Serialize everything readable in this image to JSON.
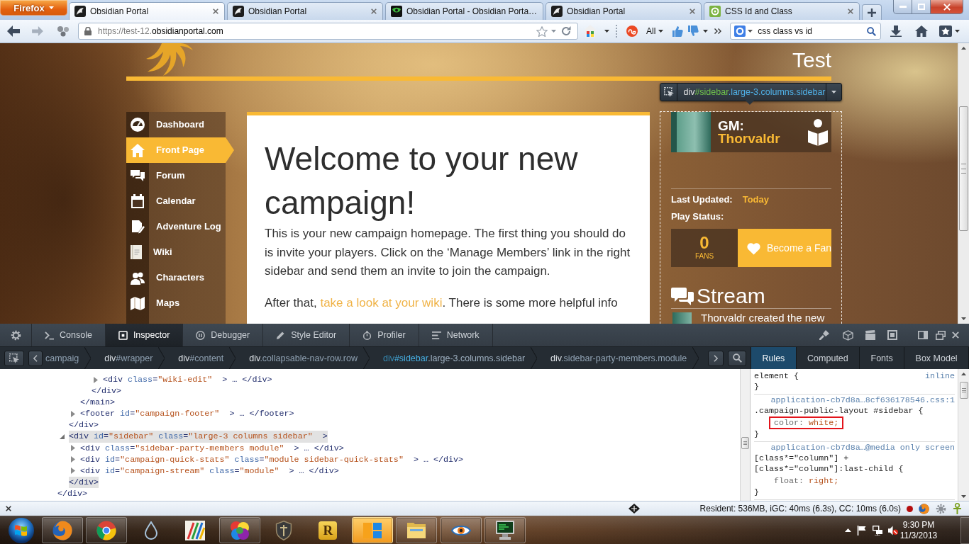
{
  "browser": {
    "menu_button": "Firefox",
    "tabs": [
      {
        "title": "Obsidian Portal",
        "selected": true
      },
      {
        "title": "Obsidian Portal",
        "selected": false
      },
      {
        "title": "Obsidian Portal - Obsidian Porta…",
        "selected": false
      },
      {
        "title": "Obsidian Portal",
        "selected": false
      },
      {
        "title": "CSS Id and Class",
        "selected": false
      }
    ],
    "address": {
      "prefix": "https://test-12.",
      "domain": "obsidianportal.com"
    },
    "toolbar_menu": "All",
    "search": {
      "value": "css class vs id"
    }
  },
  "page": {
    "campaign_title": "Test",
    "infobar": {
      "tag": "div",
      "id": "#sidebar",
      "classes": ".large-3.columns.sidebar"
    },
    "nav": [
      {
        "label": "Dashboard",
        "selected": false
      },
      {
        "label": "Front Page",
        "selected": true
      },
      {
        "label": "Forum",
        "selected": false
      },
      {
        "label": "Calendar",
        "selected": false
      },
      {
        "label": "Adventure Log",
        "selected": false
      },
      {
        "label": "Wiki",
        "selected": false
      },
      {
        "label": "Characters",
        "selected": false
      },
      {
        "label": "Maps",
        "selected": false
      }
    ],
    "heading": "Welcome to your new campaign!",
    "intro": "This is your new campaign homepage. The first thing you should do is invite your players. Click on the ‘Manage Members’ link in the right sidebar and send them an invite to join the campaign.",
    "followup": {
      "before": "After that, ",
      "link": "take a look at your wiki",
      "after": ". There is some more helpful info"
    },
    "sidebar": {
      "gm_label": "GM:",
      "gm_name": "Thorvaldr",
      "last_updated_label": "Last Updated:",
      "last_updated": "Today",
      "play_status_label": "Play Status:",
      "fan_count": "0",
      "fan_label": "FANS",
      "fan_button": "Become a Fan",
      "stream_title": "Stream",
      "stream_items": [
        "Thorvaldr created the new"
      ]
    }
  },
  "devtools": {
    "tabs": [
      {
        "label": "Console",
        "selected": false
      },
      {
        "label": "Inspector",
        "selected": true
      },
      {
        "label": "Debugger",
        "selected": false
      },
      {
        "label": "Style Editor",
        "selected": false
      },
      {
        "label": "Profiler",
        "selected": false
      },
      {
        "label": "Network",
        "selected": false
      }
    ],
    "breadcrumbs": [
      {
        "fragment": "campaig",
        "selected": false
      },
      {
        "tag": "div",
        "id": "#wrapper",
        "selected": false
      },
      {
        "tag": "div",
        "id": "#content",
        "selected": false
      },
      {
        "tag": "div",
        "classes": ".collapsable-nav-row.row",
        "selected": false
      },
      {
        "tag": "div",
        "id": "#sidebar",
        "classes": ".large-3.columns.sidebar",
        "selected": true
      },
      {
        "tag": "div",
        "classes": ".sidebar-party-members.module",
        "selected": false
      }
    ],
    "side_tabs": [
      {
        "label": "Rules",
        "selected": true
      },
      {
        "label": "Computed",
        "selected": false
      },
      {
        "label": "Fonts",
        "selected": false
      },
      {
        "label": "Box Model",
        "selected": false
      }
    ],
    "markup": [
      {
        "selected": false,
        "close": [
          {
            "kind": "close",
            "text": "</div>"
          }
        ],
        "children": [
          {
            "selected": false,
            "close": [
              {
                "kind": "close",
                "text": "</div>"
              }
            ],
            "children": [
              {
                "selected": false,
                "close": [
                  {
                    "kind": "close",
                    "text": "</main>"
                  }
                ],
                "children": [
                  {
                    "selected": false,
                    "close": [
                      {
                        "kind": "close",
                        "text": "</div>"
                      }
                    ],
                    "children": [
                      {
                        "selected": false,
                        "expanded": false,
                        "open": [
                          {
                            "kind": "tag",
                            "text": "<div"
                          },
                          {
                            "kind": "attr",
                            "text": "class"
                          },
                          {
                            "kind": "eq",
                            "text": "="
                          },
                          {
                            "kind": "value",
                            "text": "\"wiki-edit\""
                          },
                          {
                            "kind": "end",
                            "text": ">"
                          },
                          {
                            "kind": "ellipsis",
                            "text": "…"
                          },
                          {
                            "kind": "close",
                            "text": "</div>"
                          }
                        ]
                      }
                    ]
                  }
                ]
              },
              {
                "selected": false,
                "expanded": false,
                "open": [
                  {
                    "kind": "tag",
                    "text": "<footer"
                  },
                  {
                    "kind": "attr",
                    "text": "id"
                  },
                  {
                    "kind": "eq",
                    "text": "="
                  },
                  {
                    "kind": "value",
                    "text": "\"campaign-footer\""
                  },
                  {
                    "kind": "end",
                    "text": ">"
                  },
                  {
                    "kind": "ellipsis",
                    "text": "…"
                  },
                  {
                    "kind": "close",
                    "text": "</footer>"
                  }
                ]
              }
            ]
          },
          {
            "selected": true,
            "expanded": true,
            "open": [
              {
                "kind": "tag",
                "text": "<div"
              },
              {
                "kind": "attr",
                "text": "id"
              },
              {
                "kind": "eq",
                "text": "="
              },
              {
                "kind": "value",
                "text": "\"sidebar\""
              },
              {
                "kind": "attr",
                "text": "class"
              },
              {
                "kind": "eq",
                "text": "="
              },
              {
                "kind": "value",
                "text": "\"large-3 columns sidebar\""
              },
              {
                "kind": "end",
                "text": ">"
              }
            ],
            "close": [
              {
                "kind": "close",
                "text": "</div>"
              }
            ],
            "children": [
              {
                "selected": false,
                "expanded": false,
                "open": [
                  {
                    "kind": "tag",
                    "text": "<div"
                  },
                  {
                    "kind": "attr",
                    "text": "class"
                  },
                  {
                    "kind": "eq",
                    "text": "="
                  },
                  {
                    "kind": "value",
                    "text": "\"sidebar-party-members module\""
                  },
                  {
                    "kind": "end",
                    "text": ">"
                  },
                  {
                    "kind": "ellipsis",
                    "text": "…"
                  },
                  {
                    "kind": "close",
                    "text": "</div>"
                  }
                ]
              },
              {
                "selected": false,
                "expanded": false,
                "open": [
                  {
                    "kind": "tag",
                    "text": "<div"
                  },
                  {
                    "kind": "attr",
                    "text": "id"
                  },
                  {
                    "kind": "eq",
                    "text": "="
                  },
                  {
                    "kind": "value",
                    "text": "\"campaign-quick-stats\""
                  },
                  {
                    "kind": "attr",
                    "text": "class"
                  },
                  {
                    "kind": "eq",
                    "text": "="
                  },
                  {
                    "kind": "value",
                    "text": "\"module sidebar-quick-stats\""
                  },
                  {
                    "kind": "end",
                    "text": ">"
                  },
                  {
                    "kind": "ellipsis",
                    "text": "…"
                  },
                  {
                    "kind": "close",
                    "text": "</div>"
                  }
                ]
              },
              {
                "selected": false,
                "expanded": false,
                "open": [
                  {
                    "kind": "tag",
                    "text": "<div"
                  },
                  {
                    "kind": "attr",
                    "text": "id"
                  },
                  {
                    "kind": "eq",
                    "text": "="
                  },
                  {
                    "kind": "value",
                    "text": "\"campaign-stream\""
                  },
                  {
                    "kind": "attr",
                    "text": "class"
                  },
                  {
                    "kind": "eq",
                    "text": "="
                  },
                  {
                    "kind": "value",
                    "text": "\"module\""
                  },
                  {
                    "kind": "end",
                    "text": ">"
                  },
                  {
                    "kind": "ellipsis",
                    "text": "…"
                  },
                  {
                    "kind": "close",
                    "text": "</div>"
                  }
                ]
              }
            ]
          }
        ]
      }
    ],
    "rules": [
      {
        "kind": "element",
        "selector": "element {",
        "source": "inline",
        "close": "}"
      },
      {
        "kind": "stylesheet",
        "source": "application-cb7d8a…8cf636178546.css:1",
        "selector": ".campaign-public-layout #sidebar {",
        "declarations": [
          {
            "property": "color:",
            "value": "white;",
            "boxed": true
          }
        ],
        "close": "}"
      },
      {
        "kind": "stylesheet",
        "source": "application-cb7d8a…@media only screen",
        "selector": "[class*=\"column\"] + [class*=\"column\"]:last-child {",
        "declarations": [
          {
            "property": "float:",
            "value": "right;",
            "boxed": false
          }
        ],
        "close": "}"
      }
    ]
  },
  "status_bar": {
    "memory": "Resident: 536MB, iGC: 40ms (6.3s), CC: 10ms (6.0s)"
  },
  "taskbar": {
    "apps": [
      {
        "running": true,
        "flashing": false
      },
      {
        "running": true,
        "flashing": false
      },
      {
        "running": false,
        "flashing": false
      },
      {
        "running": false,
        "flashing": false
      },
      {
        "running": true,
        "flashing": false
      },
      {
        "running": false,
        "flashing": false
      },
      {
        "running": false,
        "flashing": false,
        "letter": "R"
      },
      {
        "running": true,
        "flashing": true
      },
      {
        "running": true,
        "flashing": false
      },
      {
        "running": true,
        "flashing": false
      },
      {
        "running": true,
        "flashing": false
      }
    ],
    "time": "9:30 PM",
    "date": "11/3/2013"
  }
}
